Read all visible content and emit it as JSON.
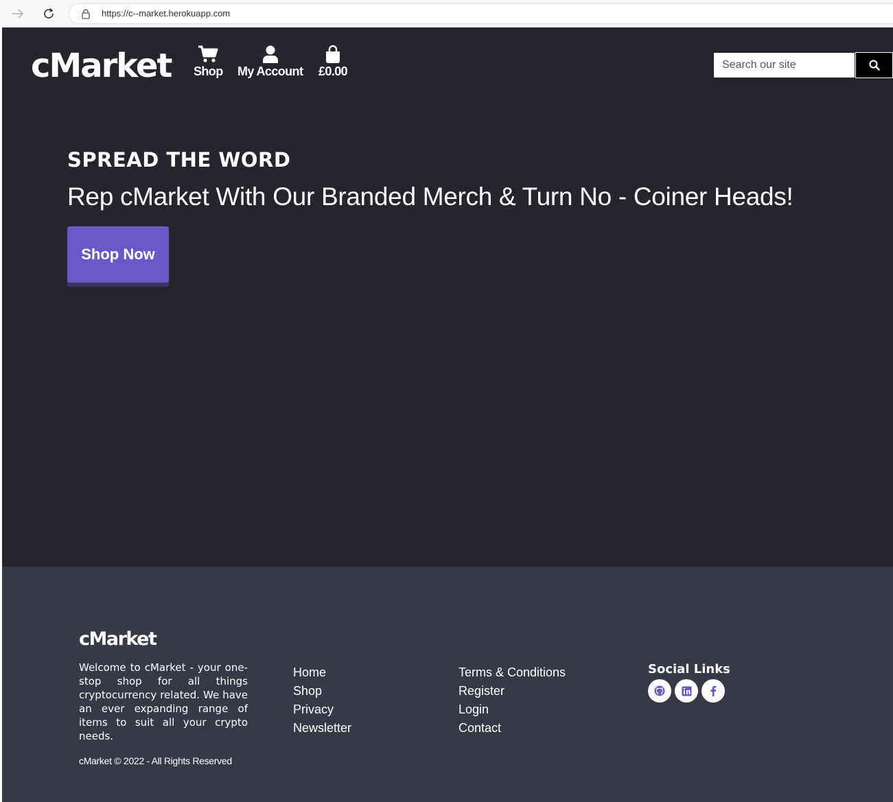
{
  "browser": {
    "url": "https://c--market.herokuapp.com"
  },
  "header": {
    "logo": "cMarket",
    "nav": [
      {
        "label": "Shop",
        "icon": "cart-icon"
      },
      {
        "label": "My Account",
        "icon": "user-icon"
      },
      {
        "label": "£0.00",
        "icon": "shopping-bag-icon"
      }
    ],
    "search": {
      "placeholder": "Search our site",
      "value": "",
      "icon": "search-icon"
    }
  },
  "hero": {
    "eyebrow": "SPREAD THE WORD",
    "title": "Rep cMarket With Our Branded Merch & Turn No - Coiner Heads!",
    "cta": "Shop Now"
  },
  "footer": {
    "logo": "cMarket",
    "about": "Welcome to cMarket - your one-stop shop for all things cryptocurrency related. We have an ever expanding range of items to suit all your crypto needs.",
    "copyright": "cMarket © 2022 - All Rights Reserved",
    "links_col1": [
      "Home",
      "Shop",
      "Privacy",
      "Newsletter"
    ],
    "links_col2": [
      "Terms & Conditions",
      "Register",
      "Login",
      "Contact"
    ],
    "social_title": "Social Links",
    "social": [
      "github-icon",
      "linkedin-icon",
      "facebook-icon"
    ]
  },
  "colors": {
    "header_bg": "#25262d",
    "footer_bg": "#373a46",
    "accent": "#6b58c8"
  }
}
